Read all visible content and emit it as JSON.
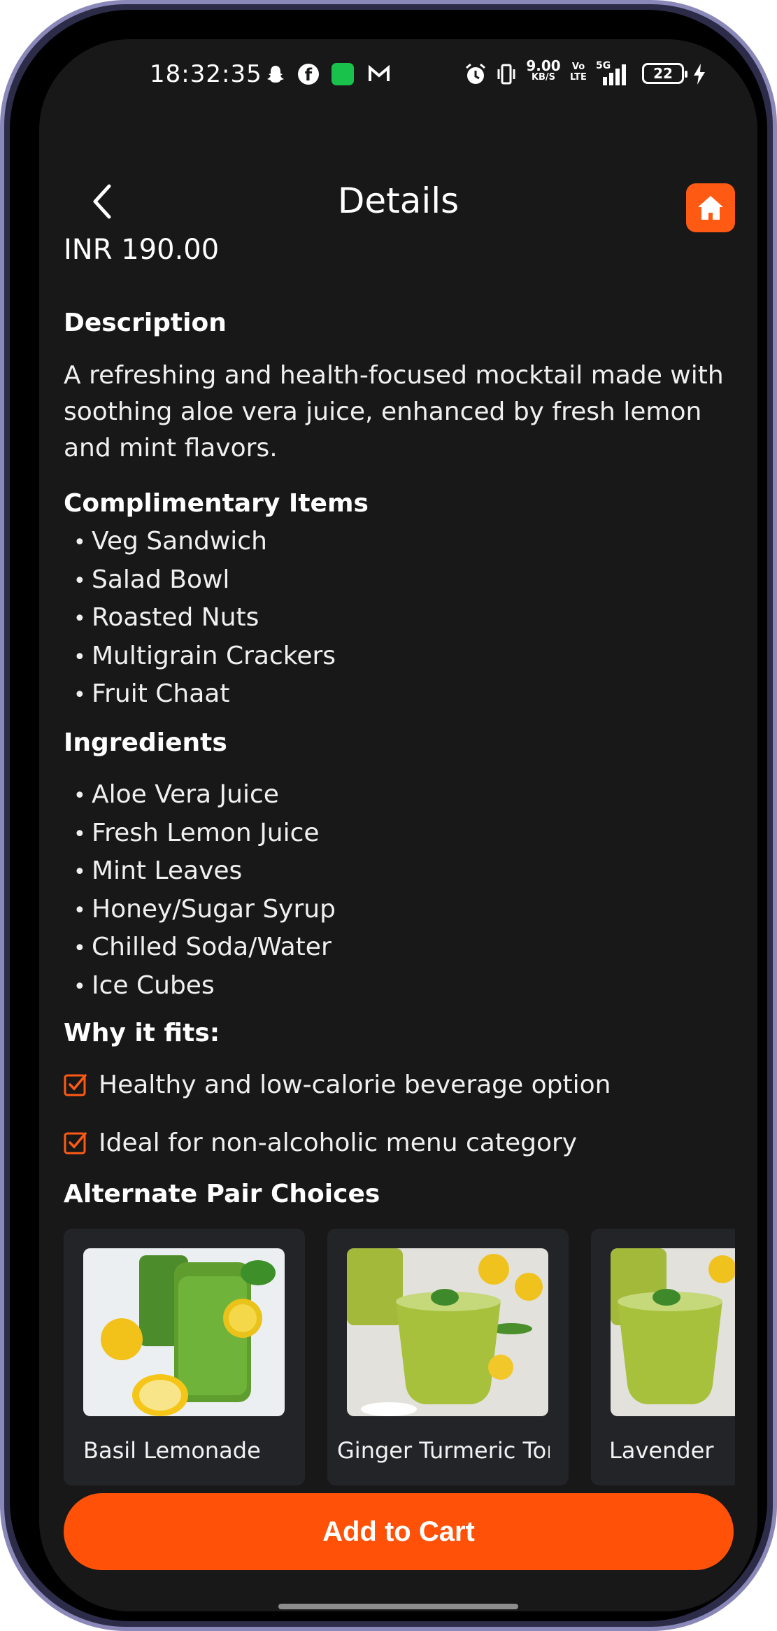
{
  "status_bar": {
    "time": "18:32:35",
    "speed_value": "9.00",
    "speed_unit": "KB/S",
    "volte_top": "Vo",
    "volte_bottom": "LTE",
    "network": "5G",
    "battery": "22",
    "icons": [
      "snapchat-icon",
      "facebook-icon",
      "app-icon",
      "gmail-icon",
      "alarm-icon",
      "vibrate-icon",
      "signal-icon",
      "battery-icon",
      "charging-icon"
    ]
  },
  "header": {
    "title": "Details",
    "back_icon": "chevron-left-icon",
    "home_icon": "home-icon"
  },
  "product": {
    "price": "INR 190.00",
    "description_title": "Description",
    "description": "A refreshing and health-focused mocktail made with soothing aloe vera juice, enhanced by fresh lemon and mint flavors."
  },
  "complimentary": {
    "title": "Complimentary Items",
    "items": [
      "Veg Sandwich",
      "Salad Bowl",
      "Roasted Nuts",
      "Multigrain Crackers",
      "Fruit Chaat"
    ]
  },
  "ingredients": {
    "title": "Ingredients",
    "items": [
      "Aloe Vera Juice",
      "Fresh Lemon Juice",
      "Mint Leaves",
      "Honey/Sugar Syrup",
      "Chilled Soda/Water",
      "Ice Cubes"
    ]
  },
  "why_it_fits": {
    "title": "Why it fits:",
    "items": [
      "Healthy and low-calorie beverage option",
      "Ideal for non-alcoholic menu category"
    ]
  },
  "alternate_pairs": {
    "title": "Alternate Pair Choices",
    "items": [
      {
        "name": "Basil Lemonade"
      },
      {
        "name": "Ginger Turmeric Tonic"
      },
      {
        "name": "Lavender Lemonade"
      }
    ]
  },
  "cart": {
    "label": "Add to Cart"
  },
  "colors": {
    "accent": "#ff5108",
    "background": "#181818",
    "card": "#232427",
    "frame": "#8a88b8"
  }
}
